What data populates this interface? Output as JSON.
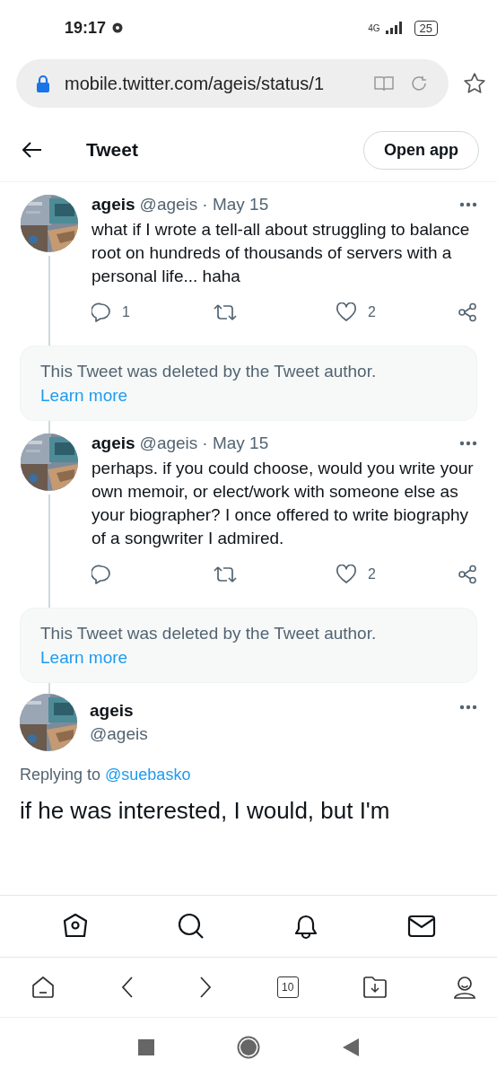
{
  "status_bar": {
    "time": "19:17",
    "network": "4G",
    "battery": "25"
  },
  "browser": {
    "url": "mobile.twitter.com/ageis/status/1",
    "tab_count": "10"
  },
  "header": {
    "title": "Tweet",
    "open_app": "Open app"
  },
  "thread": [
    {
      "kind": "tweet",
      "name": "ageis",
      "handle": "@ageis",
      "date": "· May 15",
      "text": "what if I wrote a tell-all about struggling to balance root on hundreds of thousands of servers with a personal life... haha",
      "replies": "1",
      "likes": "2"
    },
    {
      "kind": "deleted",
      "text": "This Tweet was deleted by the Tweet author.",
      "link": "Learn more"
    },
    {
      "kind": "tweet",
      "name": "ageis",
      "handle": "@ageis",
      "date": "· May 15",
      "text": "perhaps. if you could choose, would you write your own memoir, or elect/work with someone else as your biographer? I once offered to write biography of a songwriter I admired.",
      "likes": "2"
    },
    {
      "kind": "deleted",
      "text": "This Tweet was deleted by the Tweet author.",
      "link": "Learn more"
    }
  ],
  "main_tweet": {
    "name": "ageis",
    "handle": "@ageis",
    "replying_label": "Replying to",
    "replying_to": "@suebasko",
    "text": "if he was interested, I would, but I'm"
  }
}
